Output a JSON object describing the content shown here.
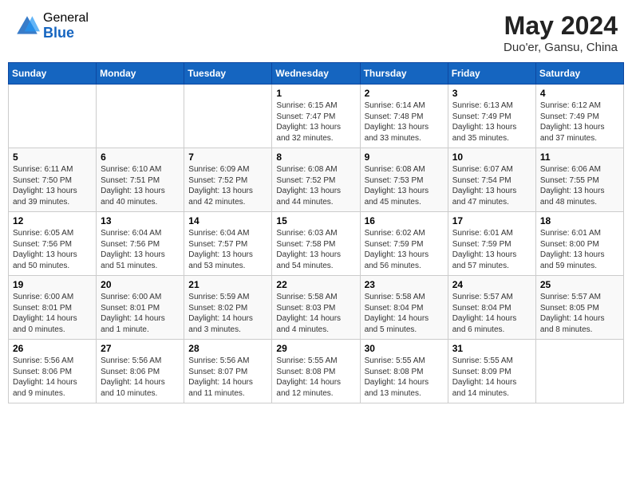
{
  "header": {
    "logo_general": "General",
    "logo_blue": "Blue",
    "month_year": "May 2024",
    "location": "Duo'er, Gansu, China"
  },
  "weekdays": [
    "Sunday",
    "Monday",
    "Tuesday",
    "Wednesday",
    "Thursday",
    "Friday",
    "Saturday"
  ],
  "weeks": [
    [
      null,
      null,
      null,
      {
        "day": 1,
        "sunrise": "6:15 AM",
        "sunset": "7:47 PM",
        "daylight": "13 hours and 32 minutes."
      },
      {
        "day": 2,
        "sunrise": "6:14 AM",
        "sunset": "7:48 PM",
        "daylight": "13 hours and 33 minutes."
      },
      {
        "day": 3,
        "sunrise": "6:13 AM",
        "sunset": "7:49 PM",
        "daylight": "13 hours and 35 minutes."
      },
      {
        "day": 4,
        "sunrise": "6:12 AM",
        "sunset": "7:49 PM",
        "daylight": "13 hours and 37 minutes."
      }
    ],
    [
      {
        "day": 5,
        "sunrise": "6:11 AM",
        "sunset": "7:50 PM",
        "daylight": "13 hours and 39 minutes."
      },
      {
        "day": 6,
        "sunrise": "6:10 AM",
        "sunset": "7:51 PM",
        "daylight": "13 hours and 40 minutes."
      },
      {
        "day": 7,
        "sunrise": "6:09 AM",
        "sunset": "7:52 PM",
        "daylight": "13 hours and 42 minutes."
      },
      {
        "day": 8,
        "sunrise": "6:08 AM",
        "sunset": "7:52 PM",
        "daylight": "13 hours and 44 minutes."
      },
      {
        "day": 9,
        "sunrise": "6:08 AM",
        "sunset": "7:53 PM",
        "daylight": "13 hours and 45 minutes."
      },
      {
        "day": 10,
        "sunrise": "6:07 AM",
        "sunset": "7:54 PM",
        "daylight": "13 hours and 47 minutes."
      },
      {
        "day": 11,
        "sunrise": "6:06 AM",
        "sunset": "7:55 PM",
        "daylight": "13 hours and 48 minutes."
      }
    ],
    [
      {
        "day": 12,
        "sunrise": "6:05 AM",
        "sunset": "7:56 PM",
        "daylight": "13 hours and 50 minutes."
      },
      {
        "day": 13,
        "sunrise": "6:04 AM",
        "sunset": "7:56 PM",
        "daylight": "13 hours and 51 minutes."
      },
      {
        "day": 14,
        "sunrise": "6:04 AM",
        "sunset": "7:57 PM",
        "daylight": "13 hours and 53 minutes."
      },
      {
        "day": 15,
        "sunrise": "6:03 AM",
        "sunset": "7:58 PM",
        "daylight": "13 hours and 54 minutes."
      },
      {
        "day": 16,
        "sunrise": "6:02 AM",
        "sunset": "7:59 PM",
        "daylight": "13 hours and 56 minutes."
      },
      {
        "day": 17,
        "sunrise": "6:01 AM",
        "sunset": "7:59 PM",
        "daylight": "13 hours and 57 minutes."
      },
      {
        "day": 18,
        "sunrise": "6:01 AM",
        "sunset": "8:00 PM",
        "daylight": "13 hours and 59 minutes."
      }
    ],
    [
      {
        "day": 19,
        "sunrise": "6:00 AM",
        "sunset": "8:01 PM",
        "daylight": "14 hours and 0 minutes."
      },
      {
        "day": 20,
        "sunrise": "6:00 AM",
        "sunset": "8:01 PM",
        "daylight": "14 hours and 1 minute."
      },
      {
        "day": 21,
        "sunrise": "5:59 AM",
        "sunset": "8:02 PM",
        "daylight": "14 hours and 3 minutes."
      },
      {
        "day": 22,
        "sunrise": "5:58 AM",
        "sunset": "8:03 PM",
        "daylight": "14 hours and 4 minutes."
      },
      {
        "day": 23,
        "sunrise": "5:58 AM",
        "sunset": "8:04 PM",
        "daylight": "14 hours and 5 minutes."
      },
      {
        "day": 24,
        "sunrise": "5:57 AM",
        "sunset": "8:04 PM",
        "daylight": "14 hours and 6 minutes."
      },
      {
        "day": 25,
        "sunrise": "5:57 AM",
        "sunset": "8:05 PM",
        "daylight": "14 hours and 8 minutes."
      }
    ],
    [
      {
        "day": 26,
        "sunrise": "5:56 AM",
        "sunset": "8:06 PM",
        "daylight": "14 hours and 9 minutes."
      },
      {
        "day": 27,
        "sunrise": "5:56 AM",
        "sunset": "8:06 PM",
        "daylight": "14 hours and 10 minutes."
      },
      {
        "day": 28,
        "sunrise": "5:56 AM",
        "sunset": "8:07 PM",
        "daylight": "14 hours and 11 minutes."
      },
      {
        "day": 29,
        "sunrise": "5:55 AM",
        "sunset": "8:08 PM",
        "daylight": "14 hours and 12 minutes."
      },
      {
        "day": 30,
        "sunrise": "5:55 AM",
        "sunset": "8:08 PM",
        "daylight": "14 hours and 13 minutes."
      },
      {
        "day": 31,
        "sunrise": "5:55 AM",
        "sunset": "8:09 PM",
        "daylight": "14 hours and 14 minutes."
      },
      null
    ]
  ]
}
